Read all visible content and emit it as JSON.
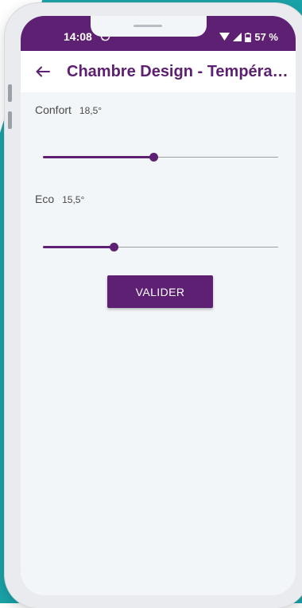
{
  "status_bar": {
    "time": "14:08",
    "battery": "57 %",
    "icons": [
      "whatsapp-icon",
      "wifi-icon",
      "signal-icon",
      "battery-icon"
    ]
  },
  "app_bar": {
    "back_icon": "arrow-left-icon",
    "title": "Chambre Design - Températu..."
  },
  "settings": [
    {
      "label": "Confort",
      "value": "18,5°",
      "slider_fraction": 0.47
    },
    {
      "label": "Eco",
      "value": "15,5°",
      "slider_fraction": 0.3
    }
  ],
  "actions": {
    "submit_label": "VALIDER"
  },
  "colors": {
    "primary": "#5d2072",
    "background": "#f3f6f9",
    "frame_accent": "#1aa3a8"
  }
}
